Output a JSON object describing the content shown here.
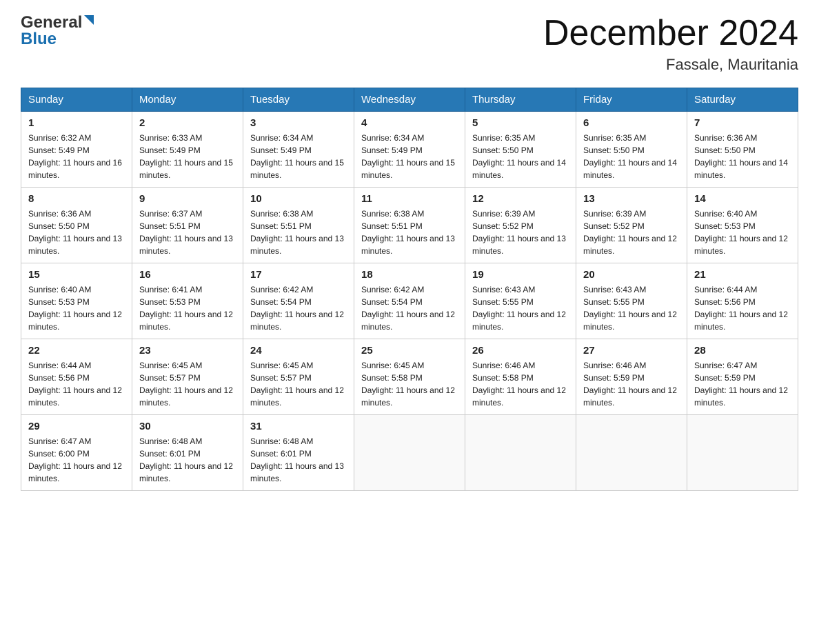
{
  "header": {
    "logo_general": "General",
    "logo_blue": "Blue",
    "title": "December 2024",
    "subtitle": "Fassale, Mauritania"
  },
  "days_of_week": [
    "Sunday",
    "Monday",
    "Tuesday",
    "Wednesday",
    "Thursday",
    "Friday",
    "Saturday"
  ],
  "weeks": [
    [
      {
        "day": "1",
        "sunrise": "6:32 AM",
        "sunset": "5:49 PM",
        "daylight": "11 hours and 16 minutes."
      },
      {
        "day": "2",
        "sunrise": "6:33 AM",
        "sunset": "5:49 PM",
        "daylight": "11 hours and 15 minutes."
      },
      {
        "day": "3",
        "sunrise": "6:34 AM",
        "sunset": "5:49 PM",
        "daylight": "11 hours and 15 minutes."
      },
      {
        "day": "4",
        "sunrise": "6:34 AM",
        "sunset": "5:49 PM",
        "daylight": "11 hours and 15 minutes."
      },
      {
        "day": "5",
        "sunrise": "6:35 AM",
        "sunset": "5:50 PM",
        "daylight": "11 hours and 14 minutes."
      },
      {
        "day": "6",
        "sunrise": "6:35 AM",
        "sunset": "5:50 PM",
        "daylight": "11 hours and 14 minutes."
      },
      {
        "day": "7",
        "sunrise": "6:36 AM",
        "sunset": "5:50 PM",
        "daylight": "11 hours and 14 minutes."
      }
    ],
    [
      {
        "day": "8",
        "sunrise": "6:36 AM",
        "sunset": "5:50 PM",
        "daylight": "11 hours and 13 minutes."
      },
      {
        "day": "9",
        "sunrise": "6:37 AM",
        "sunset": "5:51 PM",
        "daylight": "11 hours and 13 minutes."
      },
      {
        "day": "10",
        "sunrise": "6:38 AM",
        "sunset": "5:51 PM",
        "daylight": "11 hours and 13 minutes."
      },
      {
        "day": "11",
        "sunrise": "6:38 AM",
        "sunset": "5:51 PM",
        "daylight": "11 hours and 13 minutes."
      },
      {
        "day": "12",
        "sunrise": "6:39 AM",
        "sunset": "5:52 PM",
        "daylight": "11 hours and 13 minutes."
      },
      {
        "day": "13",
        "sunrise": "6:39 AM",
        "sunset": "5:52 PM",
        "daylight": "11 hours and 12 minutes."
      },
      {
        "day": "14",
        "sunrise": "6:40 AM",
        "sunset": "5:53 PM",
        "daylight": "11 hours and 12 minutes."
      }
    ],
    [
      {
        "day": "15",
        "sunrise": "6:40 AM",
        "sunset": "5:53 PM",
        "daylight": "11 hours and 12 minutes."
      },
      {
        "day": "16",
        "sunrise": "6:41 AM",
        "sunset": "5:53 PM",
        "daylight": "11 hours and 12 minutes."
      },
      {
        "day": "17",
        "sunrise": "6:42 AM",
        "sunset": "5:54 PM",
        "daylight": "11 hours and 12 minutes."
      },
      {
        "day": "18",
        "sunrise": "6:42 AM",
        "sunset": "5:54 PM",
        "daylight": "11 hours and 12 minutes."
      },
      {
        "day": "19",
        "sunrise": "6:43 AM",
        "sunset": "5:55 PM",
        "daylight": "11 hours and 12 minutes."
      },
      {
        "day": "20",
        "sunrise": "6:43 AM",
        "sunset": "5:55 PM",
        "daylight": "11 hours and 12 minutes."
      },
      {
        "day": "21",
        "sunrise": "6:44 AM",
        "sunset": "5:56 PM",
        "daylight": "11 hours and 12 minutes."
      }
    ],
    [
      {
        "day": "22",
        "sunrise": "6:44 AM",
        "sunset": "5:56 PM",
        "daylight": "11 hours and 12 minutes."
      },
      {
        "day": "23",
        "sunrise": "6:45 AM",
        "sunset": "5:57 PM",
        "daylight": "11 hours and 12 minutes."
      },
      {
        "day": "24",
        "sunrise": "6:45 AM",
        "sunset": "5:57 PM",
        "daylight": "11 hours and 12 minutes."
      },
      {
        "day": "25",
        "sunrise": "6:45 AM",
        "sunset": "5:58 PM",
        "daylight": "11 hours and 12 minutes."
      },
      {
        "day": "26",
        "sunrise": "6:46 AM",
        "sunset": "5:58 PM",
        "daylight": "11 hours and 12 minutes."
      },
      {
        "day": "27",
        "sunrise": "6:46 AM",
        "sunset": "5:59 PM",
        "daylight": "11 hours and 12 minutes."
      },
      {
        "day": "28",
        "sunrise": "6:47 AM",
        "sunset": "5:59 PM",
        "daylight": "11 hours and 12 minutes."
      }
    ],
    [
      {
        "day": "29",
        "sunrise": "6:47 AM",
        "sunset": "6:00 PM",
        "daylight": "11 hours and 12 minutes."
      },
      {
        "day": "30",
        "sunrise": "6:48 AM",
        "sunset": "6:01 PM",
        "daylight": "11 hours and 12 minutes."
      },
      {
        "day": "31",
        "sunrise": "6:48 AM",
        "sunset": "6:01 PM",
        "daylight": "11 hours and 13 minutes."
      },
      null,
      null,
      null,
      null
    ]
  ]
}
